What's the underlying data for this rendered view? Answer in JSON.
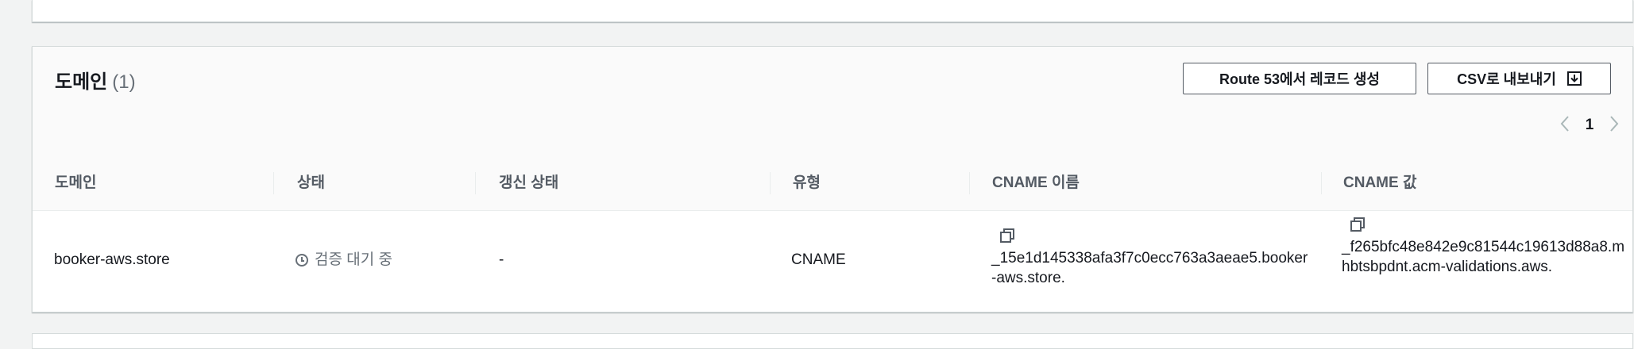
{
  "section": {
    "title": "도메인",
    "count": "(1)"
  },
  "actions": {
    "route53_label": "Route 53에서 레코드 생성",
    "csv_label": "CSV로 내보내기"
  },
  "pagination": {
    "current_page": "1"
  },
  "table": {
    "headers": [
      "도메인",
      "상태",
      "갱신 상태",
      "유형",
      "CNAME 이름",
      "CNAME 값"
    ],
    "rows": [
      {
        "domain": "booker-aws.store",
        "status": "검증 대기 중",
        "renewal_status": "-",
        "type": "CNAME",
        "cname_name": "_15e1d145338afa3f7c0ecc763a3aeae5.booker-aws.store.",
        "cname_value": "_f265bfc48e842e9c81544c19613d88a8.mhbtsbpdnt.acm-validations.aws."
      }
    ]
  },
  "colors": {
    "border": "#d5dbdb",
    "header_bg": "#fafafa",
    "muted_text": "#687078",
    "button_border": "#545b64"
  },
  "icons": {
    "download": "download-icon",
    "prev": "chevron-left-icon",
    "next": "chevron-right-icon",
    "status": "clock-icon",
    "copy": "copy-icon"
  }
}
